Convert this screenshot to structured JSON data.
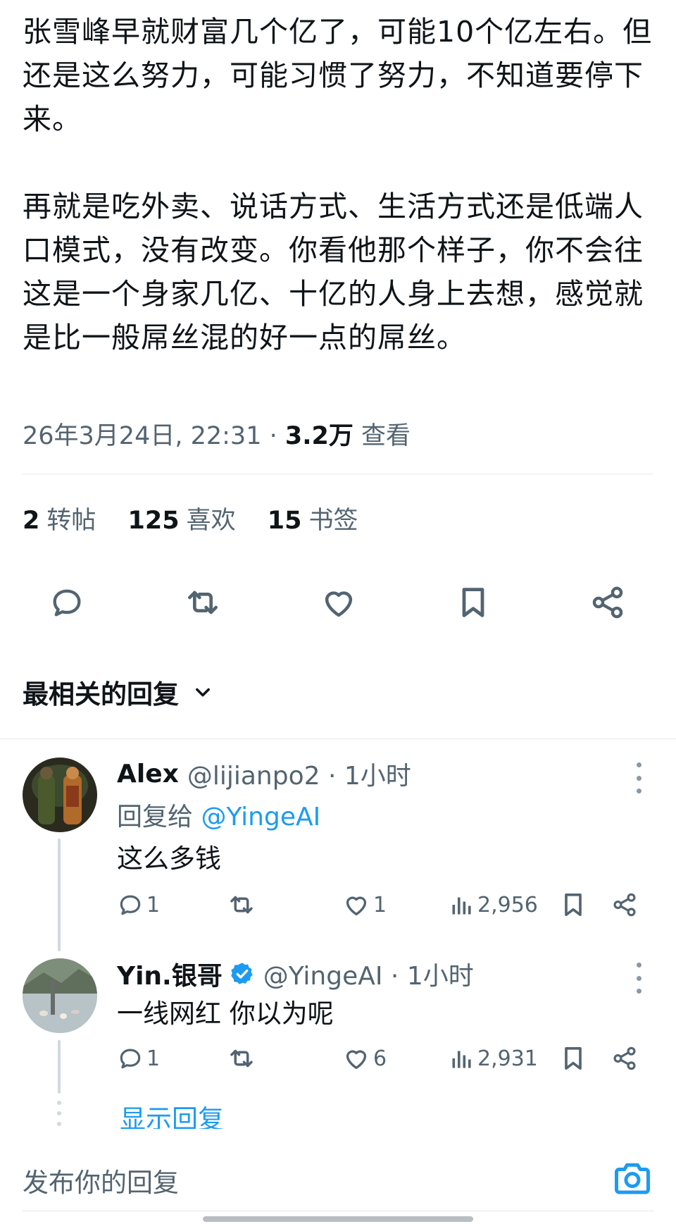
{
  "tweet": {
    "text": "张雪峰早就财富几个亿了，可能10个亿左右。但还是这么努力，可能习惯了努力，不知道要停下来。\n\n再就是吃外卖、说话方式、生活方式还是低端人口模式，没有改变。你看他那个样子，你不会往这是一个身家几亿、十亿的人身上去想，感觉就是比一般屌丝混的好一点的屌丝。",
    "timestamp": "26年3月24日, 22:31",
    "separator": " · ",
    "views_count": "3.2万",
    "views_label": "查看"
  },
  "stats": {
    "reposts_count": "2",
    "reposts_label": "转帖",
    "likes_count": "125",
    "likes_label": "喜欢",
    "bookmarks_count": "15",
    "bookmarks_label": "书签"
  },
  "actions": [
    "reply-icon",
    "repost-icon",
    "like-icon",
    "bookmark-icon",
    "share-icon"
  ],
  "sort": {
    "label": "最相关的回复"
  },
  "replies": [
    {
      "name": "Alex",
      "handle": "@lijianpo2 · 1小时",
      "reply_to_label": "回复给 ",
      "reply_to_mention": "@YingeAI",
      "text": "这么多钱",
      "reply_count": "1",
      "repost_count": "",
      "like_count": "1",
      "views": "2,956"
    },
    {
      "name": "Yin.银哥",
      "verified": true,
      "handle": "@YingeAI · 1小时",
      "text": "一线网红  你以为呢",
      "reply_count": "1",
      "repost_count": "",
      "like_count": "6",
      "views": "2,931"
    }
  ],
  "show_replies": "显示回复",
  "compose": {
    "placeholder": "发布你的回复"
  },
  "colors": {
    "accent": "#1d9bf0",
    "text": "#0f1419",
    "muted": "#536471",
    "divider": "#e6e9eb"
  }
}
